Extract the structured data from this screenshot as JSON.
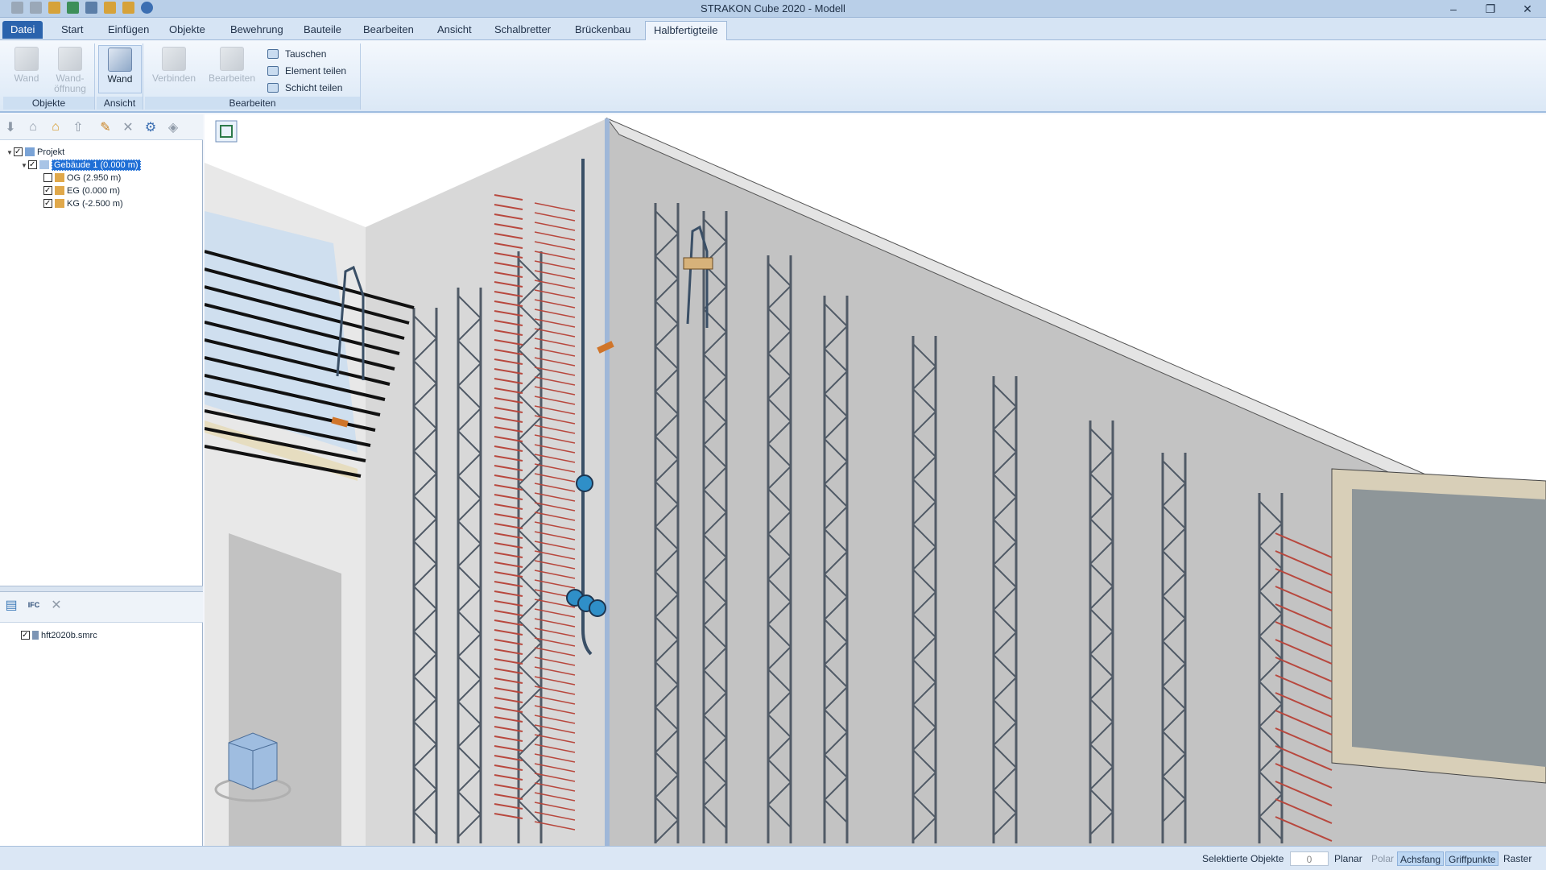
{
  "window": {
    "title": "STRAKON Cube 2020 - Modell",
    "min": "–",
    "max": "❐",
    "close": "✕"
  },
  "tabs": [
    "Datei",
    "Start",
    "Einfügen",
    "Objekte",
    "Bewehrung",
    "Bauteile",
    "Bearbeiten",
    "Ansicht",
    "Schalbretter",
    "Brückenbau",
    "Halbfertigteile"
  ],
  "ribbon": {
    "groups": {
      "objekte": {
        "label": "Objekte",
        "wand": "Wand",
        "wandoeffnung_1": "Wand-",
        "wandoeffnung_2": "öffnung"
      },
      "ansicht": {
        "label": "Ansicht",
        "wand": "Wand"
      },
      "bearbeiten": {
        "label": "Bearbeiten",
        "verbinden": "Verbinden",
        "bearbeiten": "Bearbeiten",
        "tauschen": "Tauschen",
        "element_teilen": "Element teilen",
        "schicht_teilen": "Schicht teilen"
      }
    }
  },
  "tree": {
    "root": "Projekt",
    "building": "Gebäude 1 (0.000 m)",
    "levels": [
      "OG (2.950 m)",
      "EG (0.000 m)",
      "KG (-2.500 m)"
    ],
    "level_checked": [
      false,
      true,
      true
    ]
  },
  "files": {
    "ifc_label": "IFC",
    "items": [
      "hft2020b.smrc"
    ]
  },
  "status": {
    "selected_label": "Selektierte Objekte",
    "selected_count": "0",
    "planar": "Planar",
    "polar": "Polar",
    "achsfang": "Achsfang",
    "griffpunkte": "Griffpunkte",
    "raster": "Raster"
  },
  "colors": {
    "accent": "#2a63ad",
    "rebar_red": "#b8483e",
    "lattice": "#505a66",
    "wall": "#c9c9c9"
  }
}
